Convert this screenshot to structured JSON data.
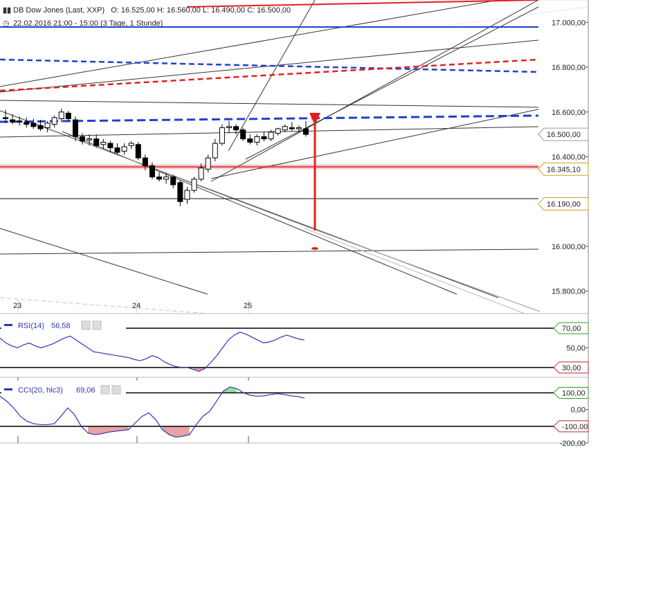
{
  "header": {
    "instrument": "DB Dow Jones (Last, XXP)",
    "ohlc": "O: 16.525,00   H: 16.560,00   L: 16.490,00   C: 16.500,00",
    "period": "22.02.2016 21:00 - 15:00 (3 Tage, 1 Stunde)"
  },
  "colors": {
    "candle_up": "#ffffff",
    "candle_down": "#000000",
    "support": "#e02020",
    "channel_blue": "#1f3fcf",
    "rsi_line": "#2a36b8",
    "cci_over": "#9be09b",
    "cci_under": "#e8a3a3"
  },
  "chart_data": [
    {
      "type": "candlestick",
      "ylim": [
        15700,
        17100
      ],
      "xlabels": [
        "23",
        "24",
        "25"
      ],
      "y_ticks": [
        "17.000,00",
        "16.800,00",
        "16.600,00",
        "16.400,00",
        "16.000,00",
        "15.800,00"
      ],
      "y_tick_values": [
        17000,
        16800,
        16600,
        16400,
        16000,
        15800
      ],
      "price_markers": [
        {
          "label": "16.500,00",
          "value": 16500,
          "style": "current"
        },
        {
          "label": "16.345,10",
          "value": 16345.1,
          "style": "gold"
        },
        {
          "label": "16.190,00",
          "value": 16190,
          "style": "gold"
        }
      ],
      "candles": [
        {
          "o": 16575,
          "h": 16610,
          "l": 16550,
          "c": 16570
        },
        {
          "o": 16565,
          "h": 16590,
          "l": 16545,
          "c": 16555
        },
        {
          "o": 16560,
          "h": 16580,
          "l": 16540,
          "c": 16555
        },
        {
          "o": 16555,
          "h": 16575,
          "l": 16530,
          "c": 16545
        },
        {
          "o": 16550,
          "h": 16570,
          "l": 16525,
          "c": 16535
        },
        {
          "o": 16540,
          "h": 16565,
          "l": 16515,
          "c": 16525
        },
        {
          "o": 16530,
          "h": 16560,
          "l": 16510,
          "c": 16550
        },
        {
          "o": 16545,
          "h": 16585,
          "l": 16530,
          "c": 16575
        },
        {
          "o": 16570,
          "h": 16615,
          "l": 16555,
          "c": 16600
        },
        {
          "o": 16595,
          "h": 16605,
          "l": 16560,
          "c": 16570
        },
        {
          "o": 16565,
          "h": 16580,
          "l": 16470,
          "c": 16490
        },
        {
          "o": 16490,
          "h": 16505,
          "l": 16455,
          "c": 16470
        },
        {
          "o": 16475,
          "h": 16500,
          "l": 16450,
          "c": 16480
        },
        {
          "o": 16480,
          "h": 16500,
          "l": 16440,
          "c": 16450
        },
        {
          "o": 16455,
          "h": 16480,
          "l": 16435,
          "c": 16465
        },
        {
          "o": 16460,
          "h": 16470,
          "l": 16420,
          "c": 16440
        },
        {
          "o": 16440,
          "h": 16460,
          "l": 16410,
          "c": 16420
        },
        {
          "o": 16425,
          "h": 16460,
          "l": 16410,
          "c": 16445
        },
        {
          "o": 16450,
          "h": 16470,
          "l": 16435,
          "c": 16460
        },
        {
          "o": 16455,
          "h": 16465,
          "l": 16385,
          "c": 16395
        },
        {
          "o": 16395,
          "h": 16410,
          "l": 16340,
          "c": 16360
        },
        {
          "o": 16360,
          "h": 16375,
          "l": 16300,
          "c": 16310
        },
        {
          "o": 16310,
          "h": 16330,
          "l": 16290,
          "c": 16300
        },
        {
          "o": 16300,
          "h": 16325,
          "l": 16280,
          "c": 16310
        },
        {
          "o": 16310,
          "h": 16320,
          "l": 16260,
          "c": 16275
        },
        {
          "o": 16285,
          "h": 16295,
          "l": 16180,
          "c": 16200
        },
        {
          "o": 16210,
          "h": 16265,
          "l": 16190,
          "c": 16250
        },
        {
          "o": 16250,
          "h": 16310,
          "l": 16240,
          "c": 16300
        },
        {
          "o": 16300,
          "h": 16370,
          "l": 16290,
          "c": 16350
        },
        {
          "o": 16345,
          "h": 16410,
          "l": 16330,
          "c": 16395
        },
        {
          "o": 16395,
          "h": 16480,
          "l": 16380,
          "c": 16460
        },
        {
          "o": 16460,
          "h": 16545,
          "l": 16450,
          "c": 16530
        },
        {
          "o": 16530,
          "h": 16560,
          "l": 16505,
          "c": 16535
        },
        {
          "o": 16535,
          "h": 16545,
          "l": 16500,
          "c": 16520
        },
        {
          "o": 16520,
          "h": 16530,
          "l": 16470,
          "c": 16480
        },
        {
          "o": 16480,
          "h": 16500,
          "l": 16455,
          "c": 16465
        },
        {
          "o": 16465,
          "h": 16500,
          "l": 16450,
          "c": 16490
        },
        {
          "o": 16490,
          "h": 16510,
          "l": 16470,
          "c": 16480
        },
        {
          "o": 16480,
          "h": 16520,
          "l": 16470,
          "c": 16510
        },
        {
          "o": 16505,
          "h": 16530,
          "l": 16495,
          "c": 16525
        },
        {
          "o": 16520,
          "h": 16545,
          "l": 16510,
          "c": 16535
        },
        {
          "o": 16530,
          "h": 16555,
          "l": 16515,
          "c": 16525
        },
        {
          "o": 16525,
          "h": 16540,
          "l": 16510,
          "c": 16530
        },
        {
          "o": 16525,
          "h": 16560,
          "l": 16490,
          "c": 16500
        }
      ]
    },
    {
      "type": "line",
      "name": "RSI(14)",
      "value_label": "56,58",
      "ylim": [
        20,
        80
      ],
      "levels": [
        {
          "label": "70,00",
          "value": 70,
          "style": "green"
        },
        {
          "label": "30,00",
          "value": 30,
          "style": "red"
        }
      ],
      "y_ticks": [
        "50,00"
      ],
      "y_tick_values": [
        50
      ],
      "values": [
        60,
        55,
        52,
        50,
        53,
        55,
        52,
        50,
        52,
        54,
        57,
        60,
        62,
        58,
        54,
        50,
        46,
        45,
        44,
        43,
        42,
        41,
        40,
        38,
        37,
        39,
        42,
        40,
        36,
        33,
        31,
        30,
        30,
        28,
        26,
        29,
        35,
        42,
        50,
        58,
        63,
        66,
        64,
        61,
        58,
        55,
        56,
        58,
        61,
        63,
        61,
        59,
        58
      ]
    },
    {
      "type": "line",
      "name": "CCI(20, hlc3)",
      "value_label": "69,06",
      "ylim": [
        -200,
        160
      ],
      "levels": [
        {
          "label": "100,00",
          "value": 100,
          "style": "green"
        },
        {
          "label": "-100,00",
          "value": -100,
          "style": "red"
        }
      ],
      "y_ticks": [
        "0,00",
        "-200,00"
      ],
      "y_tick_values": [
        0,
        -200
      ],
      "values": [
        80,
        50,
        10,
        -40,
        -70,
        -85,
        -90,
        -90,
        -85,
        -40,
        10,
        -30,
        -100,
        -140,
        -150,
        -145,
        -135,
        -130,
        -125,
        -120,
        -80,
        -40,
        -20,
        -60,
        -120,
        -150,
        -165,
        -160,
        -150,
        -90,
        -40,
        -10,
        50,
        110,
        135,
        125,
        100,
        85,
        80,
        82,
        90,
        95,
        90,
        82,
        78,
        69
      ]
    }
  ]
}
